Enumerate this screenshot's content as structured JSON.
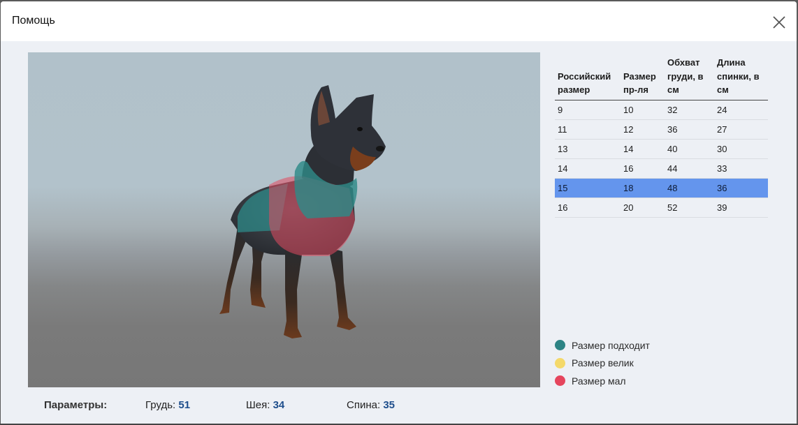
{
  "dialog": {
    "title": "Помощь",
    "close_icon": "close-icon"
  },
  "viewer": {
    "content": "3d-dog-model",
    "colors": {
      "fit": "#2e8a88",
      "small": "#e24a60"
    }
  },
  "size_table": {
    "headers": [
      "Российский размер",
      "Размер пр-ля",
      "Обхват груди, в см",
      "Длина спинки, в см"
    ],
    "rows": [
      [
        "9",
        "10",
        "32",
        "24"
      ],
      [
        "11",
        "12",
        "36",
        "27"
      ],
      [
        "13",
        "14",
        "40",
        "30"
      ],
      [
        "14",
        "16",
        "44",
        "33"
      ],
      [
        "15",
        "18",
        "48",
        "36"
      ],
      [
        "16",
        "20",
        "52",
        "39"
      ]
    ],
    "selected_row": 4,
    "selected_color": "#6495ed"
  },
  "legend": [
    {
      "label": "Размер подходит",
      "color": "#2c8384"
    },
    {
      "label": "Размер велик",
      "color": "#f4d96a"
    },
    {
      "label": "Размер мал",
      "color": "#e5455d"
    }
  ],
  "params": {
    "label": "Параметры:",
    "chest_label": "Грудь:",
    "chest_value": "51",
    "neck_label": "Шея:",
    "neck_value": "34",
    "back_label": "Спина:",
    "back_value": "35"
  }
}
